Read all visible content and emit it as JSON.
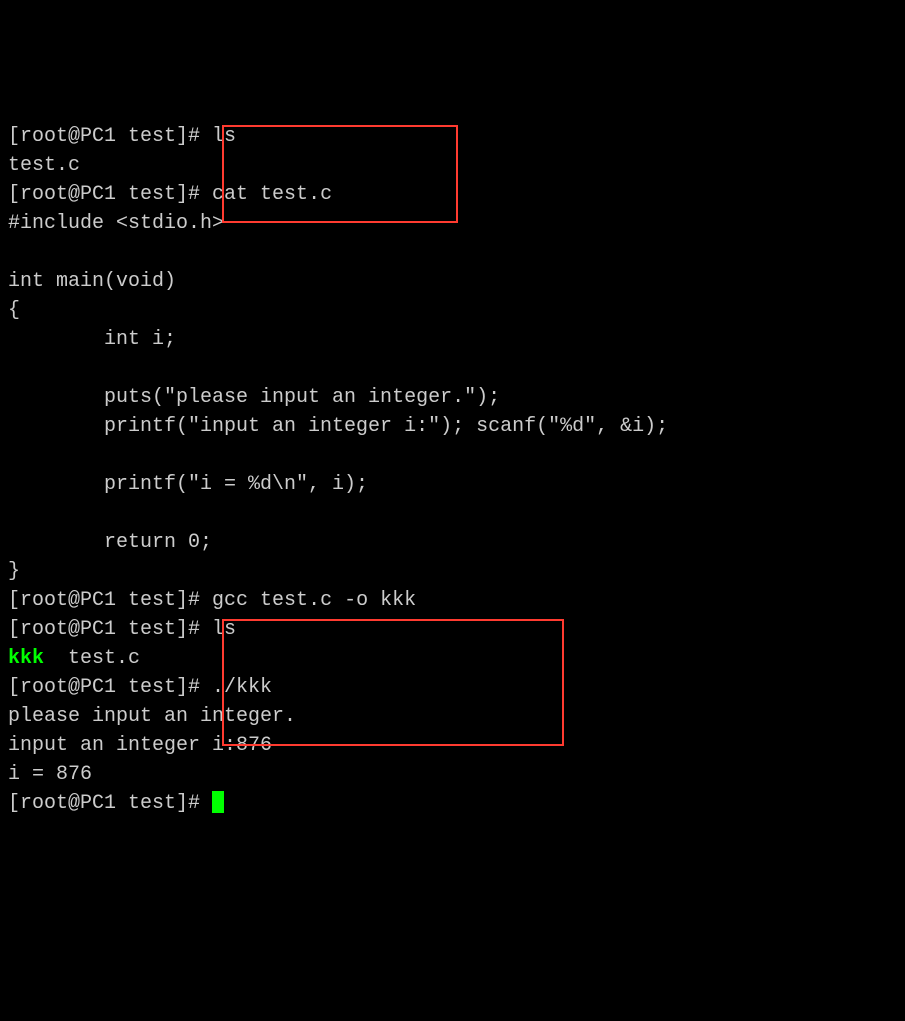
{
  "lines": {
    "l1a": "[root@PC1 test]# ",
    "l1b": "ls",
    "l2": "test.c",
    "l3a": "[root@PC1 test]# ",
    "l3b": "cat test.c",
    "l4": "#include <stdio.h>",
    "l5": "",
    "l6": "int main(void)",
    "l7": "{",
    "l8": "        int i;",
    "l9": "",
    "l10": "        puts(\"please input an integer.\");",
    "l11": "        printf(\"input an integer i:\"); scanf(\"%d\", &i);",
    "l12": "",
    "l13": "        printf(\"i = %d\\n\", i);",
    "l14": "",
    "l15": "        return 0;",
    "l16": "}",
    "l17a": "[root@PC1 test]# ",
    "l17b": "gcc test.c -o kkk",
    "l18a": "[root@PC1 test]# ",
    "l18b": "ls",
    "l19a": "kkk",
    "l19b": "  test.c",
    "l20a": "[root@PC1 test]# ",
    "l20b": "./kkk",
    "l21": "please input an integer.",
    "l22": "input an integer i:876",
    "l23": "i = 876",
    "l24a": "[root@PC1 test]# "
  }
}
